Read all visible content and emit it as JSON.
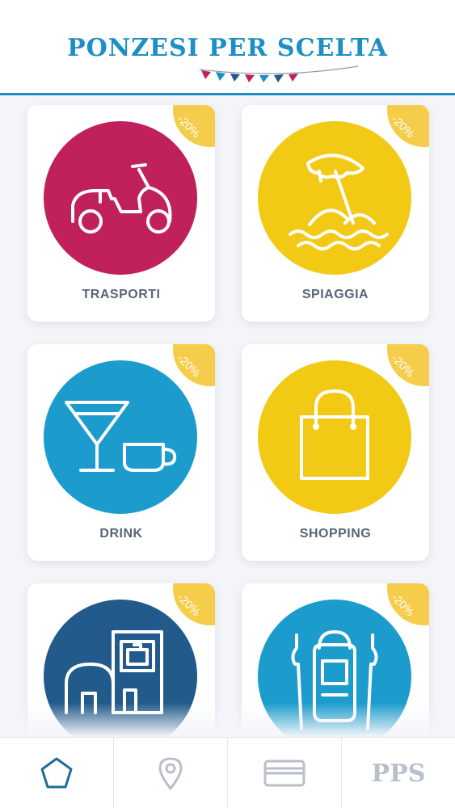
{
  "header": {
    "logo_text": "PONZESI PER SCELTA",
    "accent_color": "#1d8fc4"
  },
  "categories": [
    {
      "label": "TRASPORTI",
      "badge": "-20%",
      "icon": "scooter-icon",
      "color": "#c0215c"
    },
    {
      "label": "SPIAGGIA",
      "badge": "-20%",
      "icon": "beach-umbrella-icon",
      "color": "#f2ca16"
    },
    {
      "label": "DRINK",
      "badge": "-20%",
      "icon": "cocktail-cup-icon",
      "color": "#1c9ccd"
    },
    {
      "label": "SHOPPING",
      "badge": "-20%",
      "icon": "shopping-bag-icon",
      "color": "#f2ca16"
    },
    {
      "label": "",
      "badge": "-20%",
      "icon": "hotel-building-icon",
      "color": "#225a8c"
    },
    {
      "label": "",
      "badge": "-20%",
      "icon": "hiking-backpack-icon",
      "color": "#1c9ccd"
    }
  ],
  "tabbar": {
    "items": [
      {
        "icon": "home-pentagon-icon"
      },
      {
        "icon": "map-pin-icon"
      },
      {
        "icon": "card-icon"
      },
      {
        "label": "PPS"
      }
    ]
  }
}
